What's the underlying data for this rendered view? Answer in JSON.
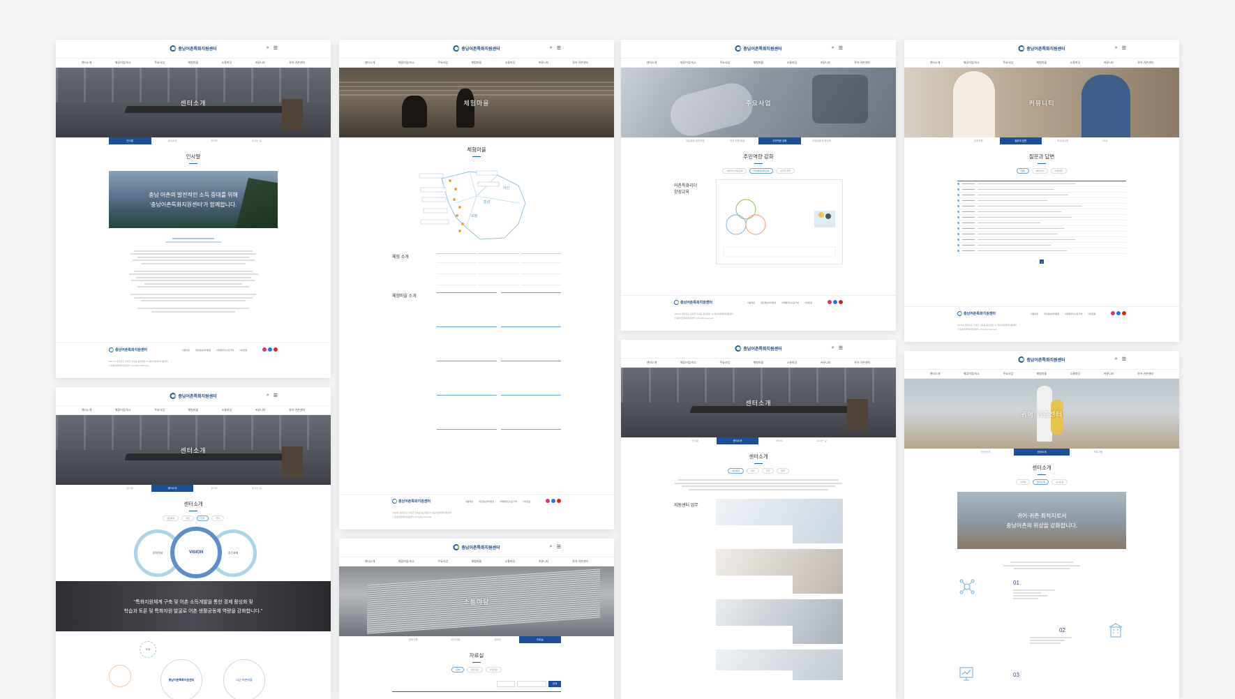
{
  "common": {
    "logo_text": "충남어촌특화지원센터",
    "gnb": [
      "센터소개",
      "체류어업/숙소",
      "주요사업",
      "체험마을",
      "소통마당",
      "커뮤니티",
      "귀어·귀촌센터"
    ],
    "footer_links": [
      "이용약관",
      "개인정보처리방침",
      "이메일무단수집거부",
      "사이트맵"
    ],
    "footer_address": "(32121) 충청남도 홍성군 홍북읍 충남대로 21 충남어촌특화지원센터",
    "footer_contact": "Tel. 041-000-0000   Mail. cfic@cfic.or.kr",
    "footer_copy": "© 충남어촌특화지원센터. All rights reserved.",
    "colors": {
      "primary": "#1a4f9c",
      "accent_green": "#6cc04a",
      "instagram": "#e1306c",
      "facebook": "#1877f2",
      "youtube": "#e62117"
    }
  },
  "cards": {
    "greeting": {
      "hero_title": "센터소개",
      "tabs": [
        "인사말",
        "센터소개",
        "조직도",
        "오시는 길"
      ],
      "section_title": "인사말",
      "banner_line1": "충남 어촌의 발전적인 소득 증대를 위해",
      "banner_line2": "'충남어촌특화지원센터'가 함께합니다."
    },
    "village": {
      "hero_title": "체험마을",
      "section_title": "체험마을",
      "exp_label": "체험 소개",
      "village_label": "체험마을 소개",
      "map_labels": [
        "당진",
        "서산",
        "태안",
        "홍성",
        "보령",
        "서천",
        "아산",
        "천안"
      ]
    },
    "business": {
      "hero_title": "주요사업",
      "tabs": [
        "어촌특화 발전지원",
        "어촌 자원 발굴",
        "주민역량 강화",
        "어촌공동체 활성화"
      ],
      "section_title": "주민역량 강화",
      "pills": [
        "어촌리더 양성교육",
        "주민역량강화교육",
        "선진지 견학"
      ],
      "side_label1": "어촌특화리더",
      "side_label2": "양성교육"
    },
    "community": {
      "hero_title": "커뮤니티",
      "tabs": [
        "공지사항",
        "질문과 답변",
        "자유게시판",
        "FAQ"
      ],
      "section_title": "질문과 답변",
      "pills": [
        "전체",
        "센터관련",
        "사업관련"
      ],
      "page_current": "1"
    },
    "vision": {
      "hero_title": "센터소개",
      "tabs": [
        "인사말",
        "센터소개",
        "조직도",
        "오시는 길"
      ],
      "section_title": "센터소개",
      "pills": [
        "설립목적",
        "비전",
        "조직",
        "연혁"
      ],
      "circle_left": "전략목표",
      "circle_center": "VISION",
      "circle_right": "추진과제",
      "quote_line1": "\"특화지원체계 구축 및 어촌 소득개발을 통한 경제 활성화 및",
      "quote_line2": "학습과 토론 및 특화자원 발굴로 어촌 생활공동체 역량을 강화합니다.\"",
      "org_center": "충남어촌특화지원센터",
      "org_right": "시군 어촌마을",
      "org_top": "도청"
    },
    "board": {
      "hero_title": "소통마당",
      "tabs": [
        "공지사항",
        "보도자료",
        "갤러리",
        "자료실"
      ],
      "section_title": "자료실",
      "pills": [
        "전체",
        "센터자료",
        "사업자료"
      ],
      "search_button": "검색"
    },
    "center": {
      "hero_title": "센터소개",
      "tabs": [
        "인사말",
        "센터소개",
        "조직도",
        "오시는 길"
      ],
      "section_title": "센터소개",
      "pills": [
        "설립목적",
        "비전",
        "조직",
        "연혁"
      ],
      "side_label": "지원센터 업무"
    },
    "return": {
      "hero_title": "귀어·귀촌센터",
      "tabs": [
        "센터안내",
        "센터소개",
        "프로그램"
      ],
      "section_title": "센터소개",
      "pills": [
        "인사말",
        "센터소개",
        "오시는길"
      ],
      "banner_line1": "귀어·귀촌 최적지로서",
      "banner_line2": "충남어촌의 위상을 강화합니다.",
      "step1": "01",
      "step2": "02",
      "step3": "03"
    }
  }
}
